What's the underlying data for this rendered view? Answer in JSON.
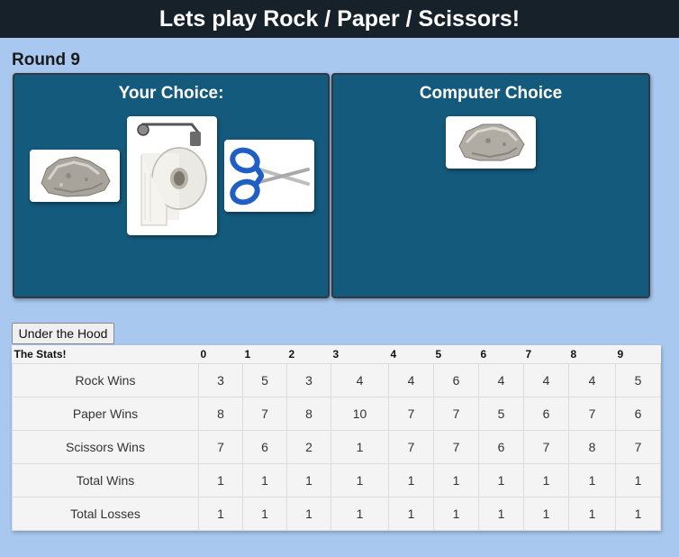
{
  "header": {
    "title": "Lets play Rock / Paper / Scissors!"
  },
  "round": {
    "label": "Round 9"
  },
  "your_choice": {
    "title": "Your Choice:",
    "options": [
      {
        "name": "rock",
        "icon": "rock-image"
      },
      {
        "name": "paper",
        "icon": "toilet-paper-image"
      },
      {
        "name": "scissors",
        "icon": "scissors-image"
      }
    ]
  },
  "computer_choice": {
    "title": "Computer Choice",
    "selected": {
      "name": "rock",
      "icon": "rock-image"
    }
  },
  "hood_button": {
    "label": "Under the Hood"
  },
  "stats": {
    "title": "The Stats!",
    "columns": [
      "0",
      "1",
      "2",
      "3",
      "4",
      "5",
      "6",
      "7",
      "8",
      "9"
    ],
    "rows": [
      {
        "label": "Rock Wins",
        "values": [
          "3",
          "5",
          "3",
          "4",
          "4",
          "6",
          "4",
          "4",
          "4",
          "5"
        ]
      },
      {
        "label": "Paper Wins",
        "values": [
          "8",
          "7",
          "8",
          "10",
          "7",
          "7",
          "5",
          "6",
          "7",
          "6"
        ]
      },
      {
        "label": "Scissors Wins",
        "values": [
          "7",
          "6",
          "2",
          "1",
          "7",
          "7",
          "6",
          "7",
          "8",
          "7"
        ]
      },
      {
        "label": "Total Wins",
        "values": [
          "1",
          "1",
          "1",
          "1",
          "1",
          "1",
          "1",
          "1",
          "1",
          "1"
        ]
      },
      {
        "label": "Total Losses",
        "values": [
          "1",
          "1",
          "1",
          "1",
          "1",
          "1",
          "1",
          "1",
          "1",
          "1"
        ]
      }
    ]
  },
  "colors": {
    "background": "#a9c8ef",
    "header": "#16212a",
    "panel": "#145a7c",
    "scissors_handle": "#1f5fc4"
  }
}
